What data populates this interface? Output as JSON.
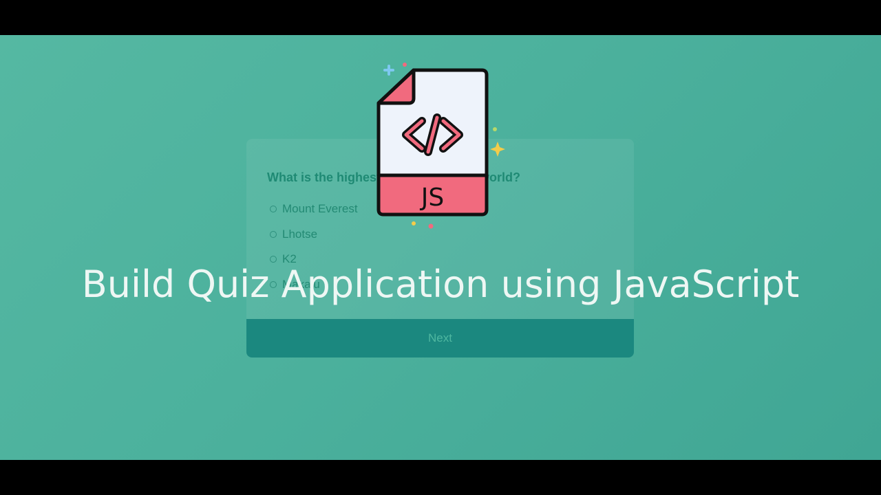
{
  "overlay": {
    "title": "Build Quiz Application using JavaScript"
  },
  "quiz": {
    "question": "What is the highest mountain in the world?",
    "answers": [
      "Mount Everest",
      "Lhotse",
      "K2",
      "Makalu"
    ],
    "next_label": "Next"
  },
  "icon": {
    "name": "js-file-icon",
    "label": "JS",
    "code_symbol": "</>"
  },
  "colors": {
    "background": "#4cb19d",
    "button": "#1b887f",
    "icon_pink": "#f16a7e",
    "title_text": "#eef7f4"
  }
}
